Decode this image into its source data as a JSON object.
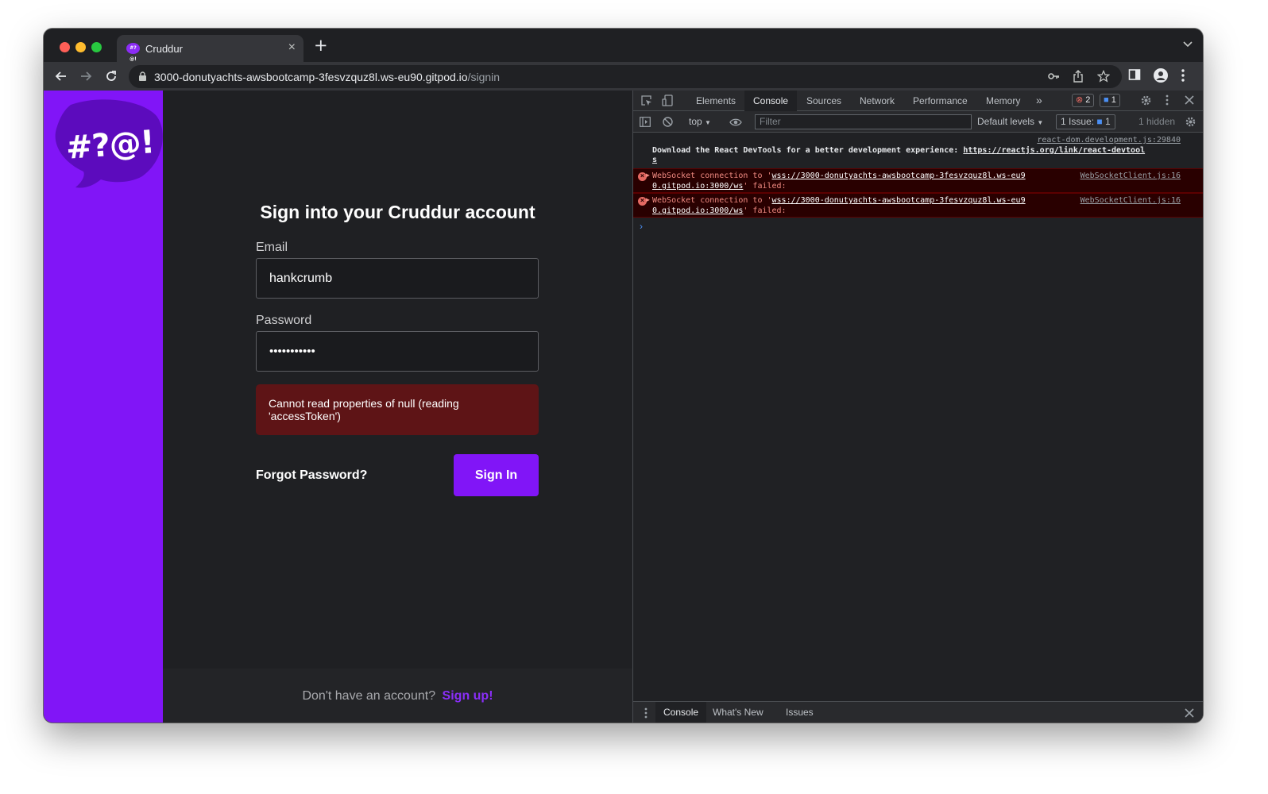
{
  "browser": {
    "tab_title": "Cruddur",
    "url_host": "3000-donutyachts-awsbootcamp-3fesvzquz8l.ws-eu90.gitpod.io",
    "url_path": "/signin"
  },
  "page": {
    "logo_text": "#?@!",
    "title": "Sign into your Cruddur account",
    "email_label": "Email",
    "email_value": "hankcrumb",
    "password_label": "Password",
    "password_value": "•••••••••••",
    "error_message": "Cannot read properties of null (reading 'accessToken')",
    "forgot_label": "Forgot Password?",
    "signin_label": "Sign In",
    "footer_question": "Don't have an account?",
    "footer_link": "Sign up!"
  },
  "devtools": {
    "tabs": [
      "Elements",
      "Console",
      "Sources",
      "Network",
      "Performance",
      "Memory"
    ],
    "error_count": "2",
    "message_count": "1",
    "context": "top",
    "filter_placeholder": "Filter",
    "levels": "Default levels",
    "issues_label": "1 Issue:",
    "issues_count": "1",
    "hidden": "1 hidden",
    "messages": {
      "info_source": "react-dom.development.js:29840",
      "info_text": "Download the React DevTools for a better development experience: ",
      "info_link": "https://reactjs.org/link/react-devtool",
      "info_link_tail": "s",
      "error_prefix": "WebSocket connection to '",
      "error_url_a": "wss://3000-donutyachts-awsbootcamp-3fesvzquz8l.ws-eu9",
      "error_url_b": "0.gitpod.io:3000/ws",
      "error_suffix": "' failed:",
      "error_source": "WebSocketClient.js:16"
    },
    "drawer_tabs": [
      "Console",
      "What's New",
      "Issues"
    ]
  },
  "colors": {
    "brand_purple": "#8115f7",
    "error_bg": "#5e1416"
  }
}
